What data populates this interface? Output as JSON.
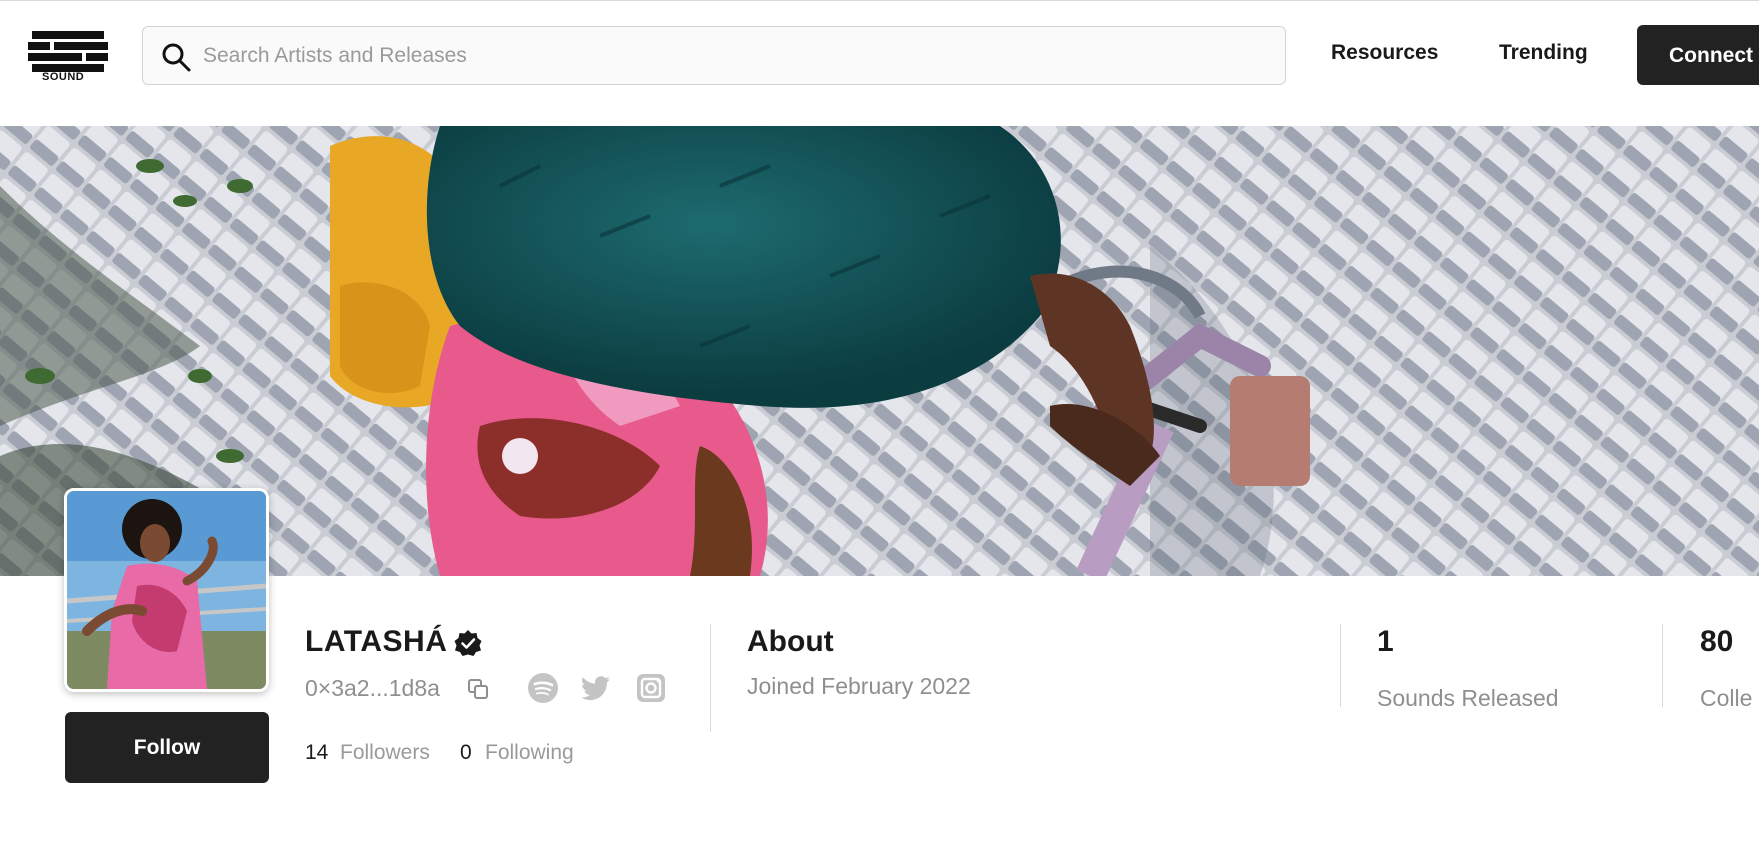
{
  "header": {
    "logo_text": "SOUND",
    "search": {
      "placeholder": "Search Artists and Releases",
      "value": ""
    },
    "nav": [
      {
        "label": "Resources"
      },
      {
        "label": "Trending"
      }
    ],
    "connect_label": "Connect"
  },
  "profile": {
    "name": "LATASHÁ",
    "wallet": "0×3a2...1d8a",
    "follow_label": "Follow",
    "followers_count": "14",
    "followers_label": "Followers",
    "following_count": "0",
    "following_label": "Following"
  },
  "about": {
    "title": "About",
    "joined": "Joined February 2022"
  },
  "stats": [
    {
      "value": "1",
      "label": "Sounds Released"
    },
    {
      "value": "80",
      "label": "Colle"
    }
  ],
  "icons": {
    "search": "search-icon",
    "verified": "verified-check-icon",
    "copy": "copy-icon",
    "spotify": "spotify-icon",
    "twitter": "twitter-icon",
    "instagram": "instagram-icon"
  },
  "colors": {
    "primary_button": "#222222",
    "muted_text": "#8f8f8f",
    "icon_gray": "#c4c4c4"
  }
}
